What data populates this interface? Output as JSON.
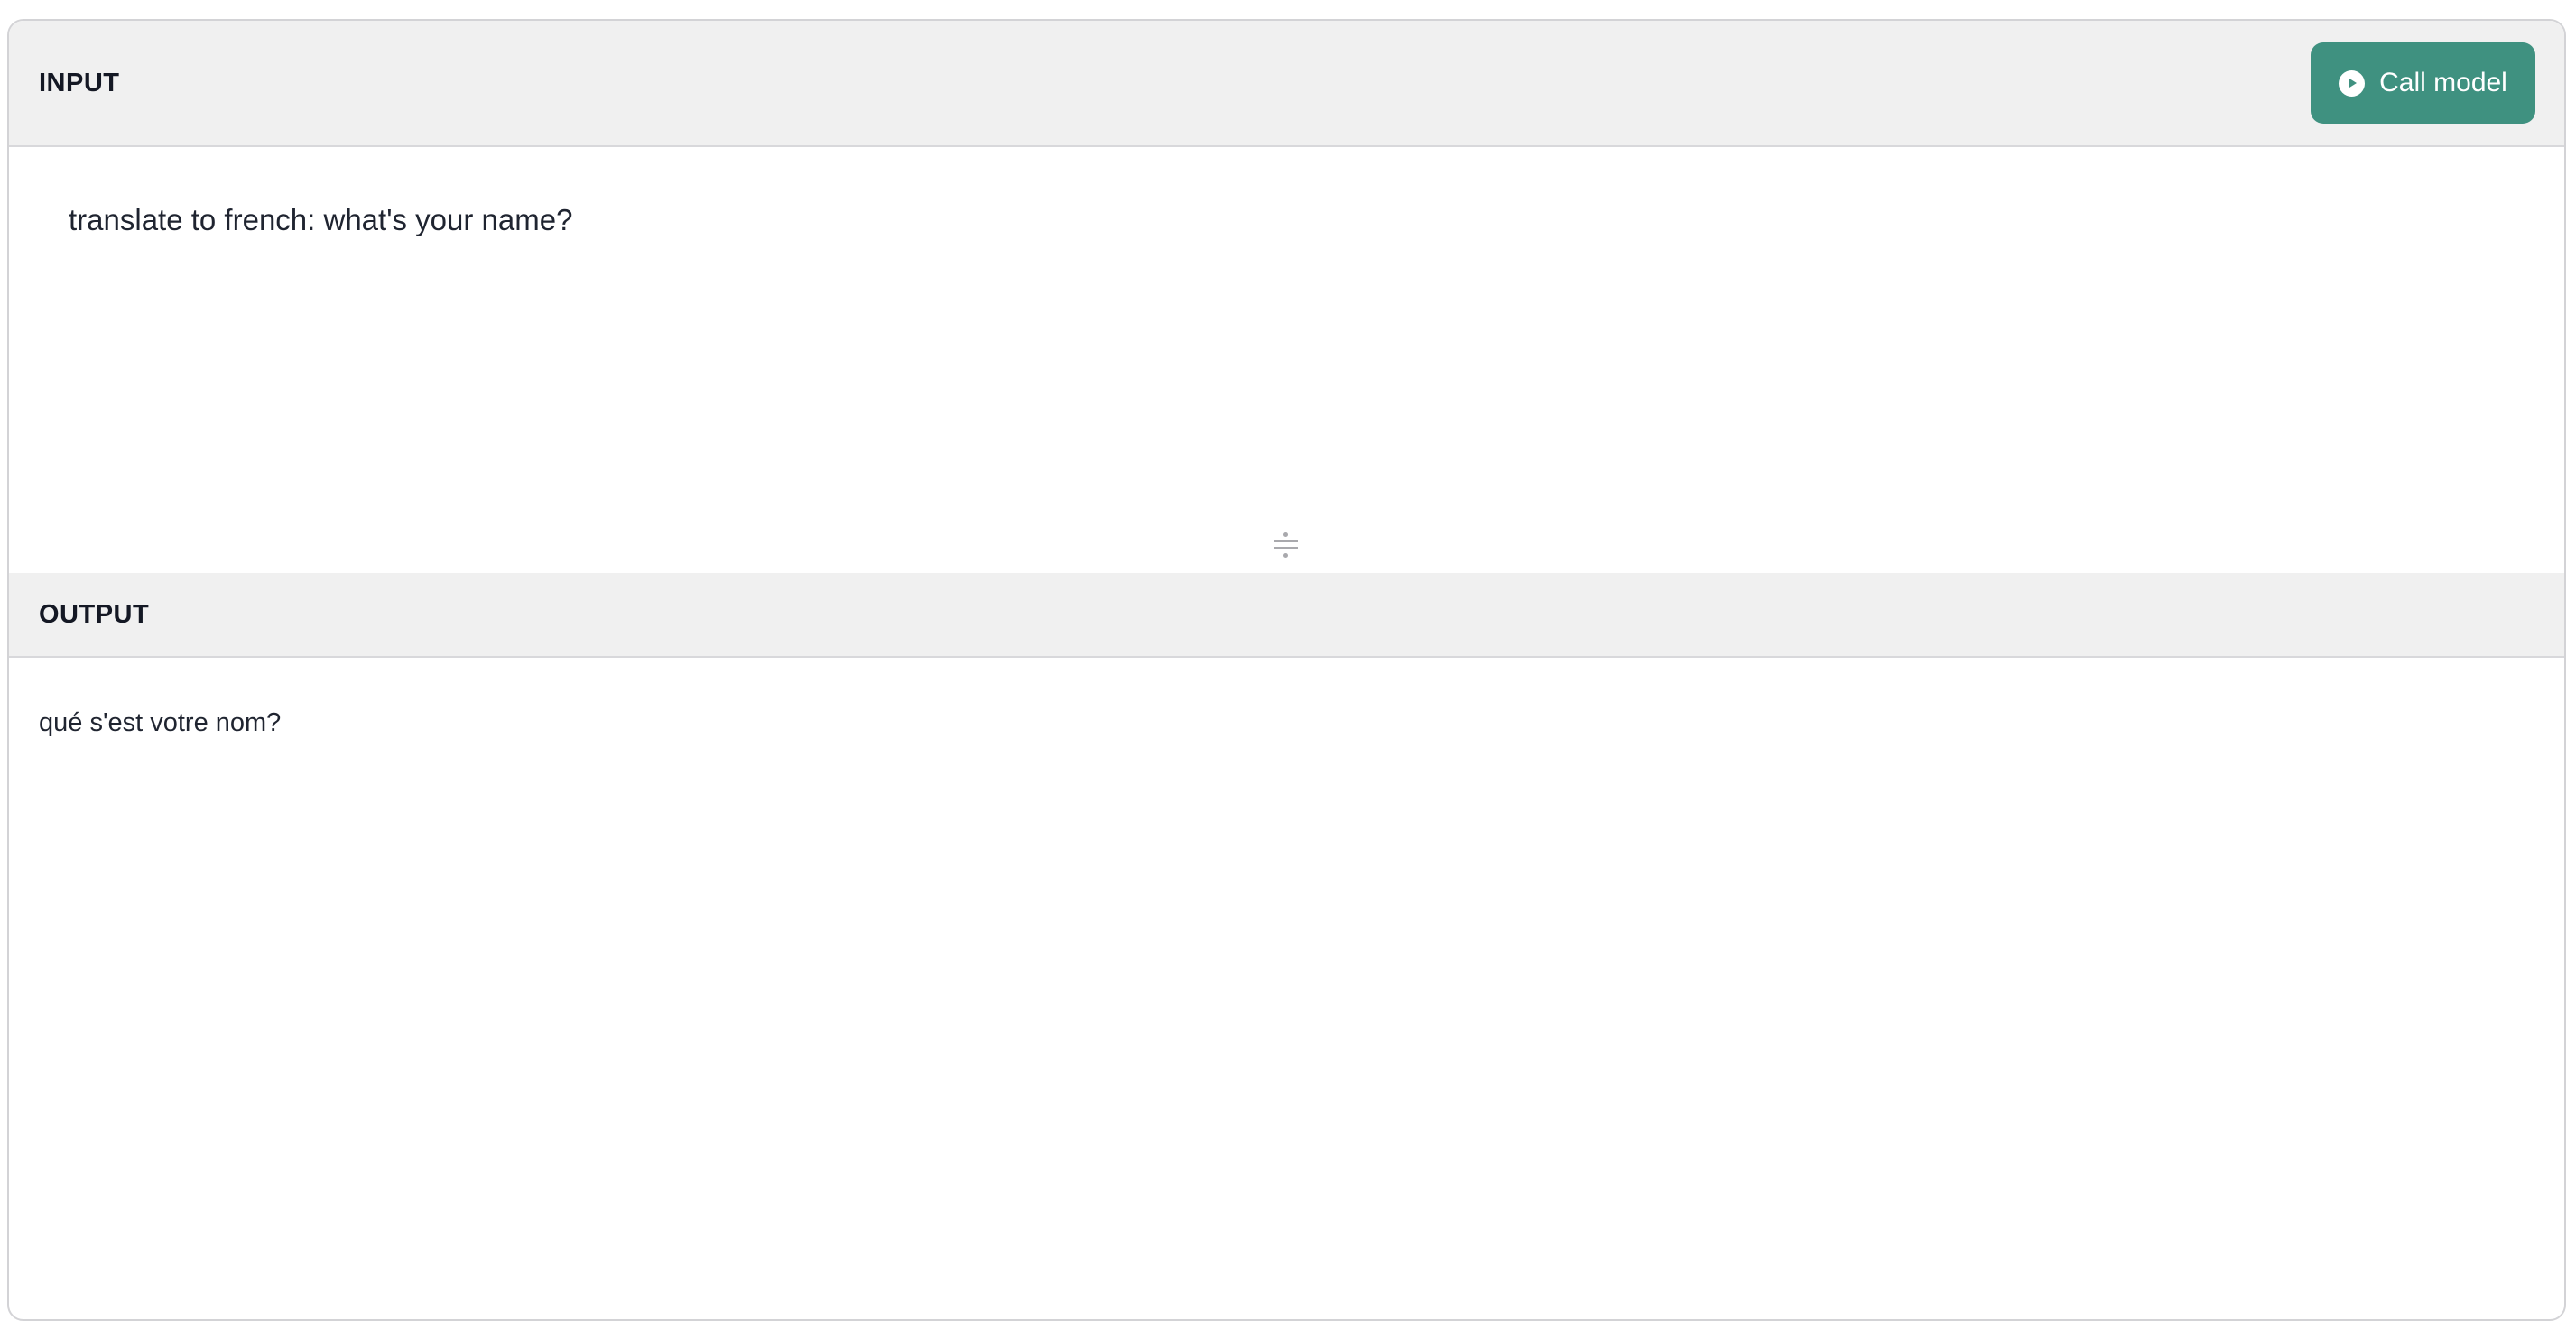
{
  "input_section": {
    "label": "INPUT",
    "call_button_label": "Call model",
    "call_button_icon": "play-circle-icon",
    "text": "translate to french: what's your name?"
  },
  "output_section": {
    "label": "OUTPUT",
    "text": "qué s'est votre nom?"
  },
  "colors": {
    "accent": "#3f9180",
    "header_bg": "#f0f0f0",
    "border": "#d3d3d6"
  }
}
